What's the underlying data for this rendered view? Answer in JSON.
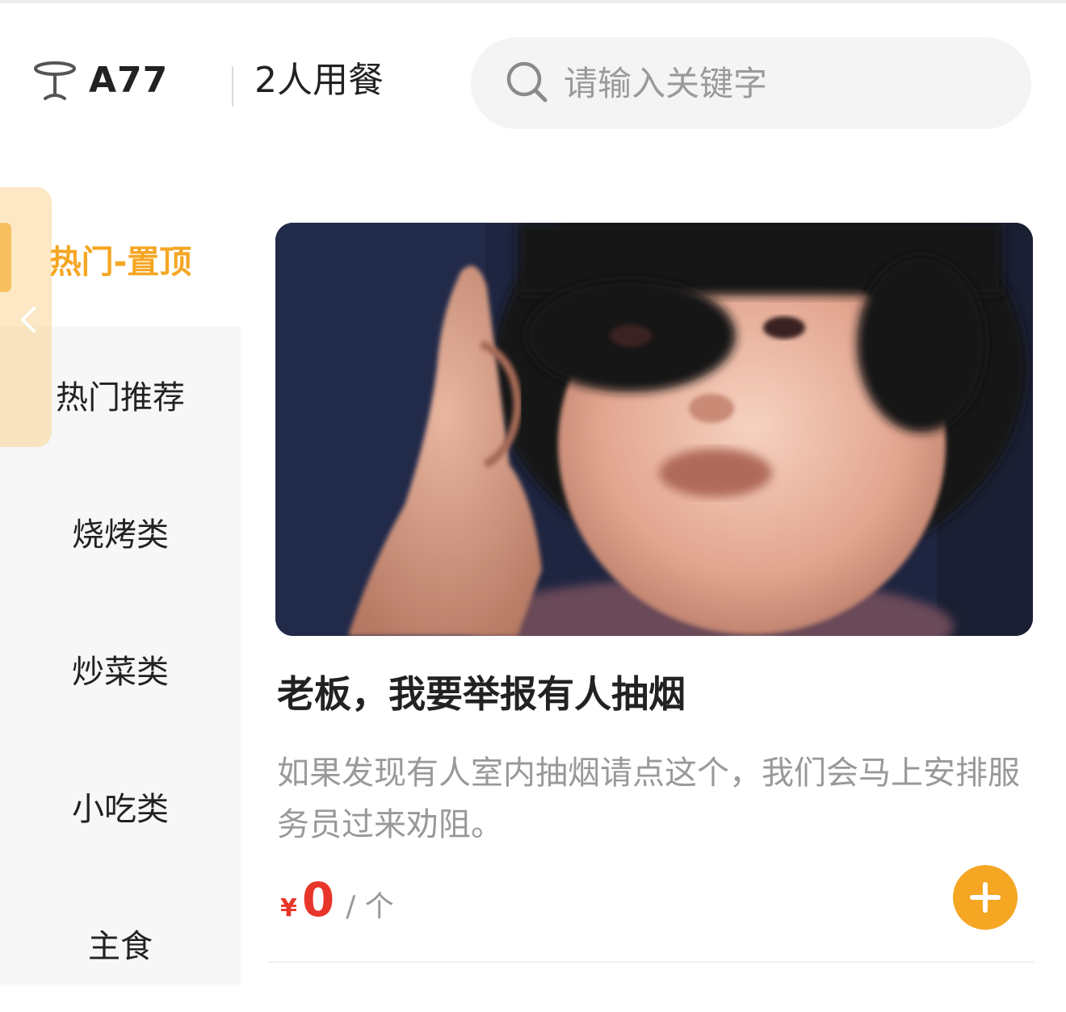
{
  "header": {
    "table_code": "A77",
    "diners": "2人用餐",
    "search": {
      "placeholder": "请输入关键字",
      "value": ""
    }
  },
  "sidebar": {
    "items": [
      {
        "label": "热门-置顶",
        "active": true
      },
      {
        "label": "热门推荐",
        "active": false
      },
      {
        "label": "烧烤类",
        "active": false
      },
      {
        "label": "炒菜类",
        "active": false
      },
      {
        "label": "小吃类",
        "active": false
      },
      {
        "label": "主食",
        "active": false
      }
    ]
  },
  "product": {
    "title": "老板，我要举报有人抽烟",
    "description": "如果发现有人室内抽烟请点这个，我们会马上安排服务员过来劝阻。",
    "price_symbol": "¥",
    "price": "0",
    "unit": "/ 个"
  },
  "colors": {
    "accent": "#f5a623",
    "price": "#e8362a",
    "sidebar_bg": "#f7f7f7",
    "search_bg": "#f4f4f4"
  },
  "icons": {
    "table": "table-icon",
    "search": "search-icon",
    "collapse": "chevron-left-icon",
    "add": "plus-icon"
  }
}
